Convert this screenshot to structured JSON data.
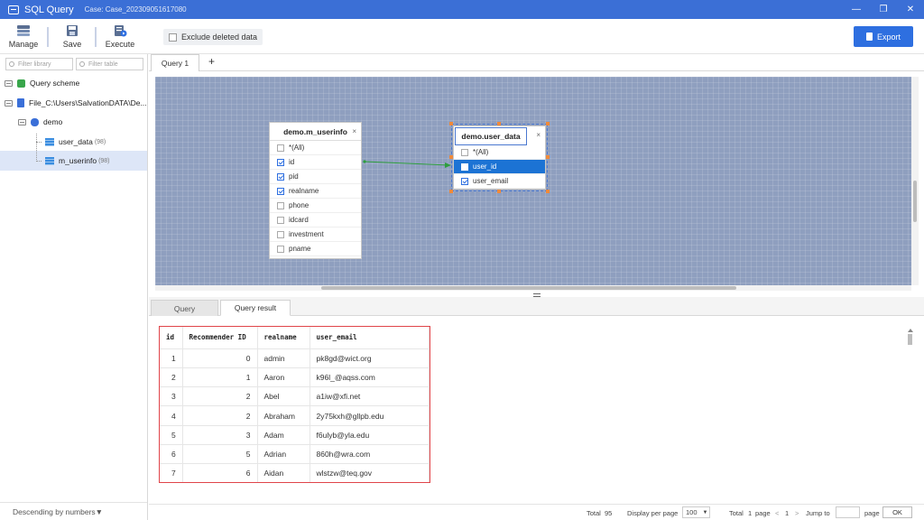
{
  "titlebar": {
    "title": "SQL Query",
    "case": "Case: Case_202309051617080",
    "minimize": "—",
    "restore": "❐",
    "close": "✕"
  },
  "toolbar": {
    "manage_label": "Manage",
    "save_label": "Save",
    "execute_label": "Execute",
    "exclude_label": "Exclude deleted data",
    "export_label": "Export"
  },
  "sidebar": {
    "filter_library_placeholder": "Filter library",
    "filter_table_placeholder": "Filter table",
    "items": [
      {
        "label": "Query scheme"
      },
      {
        "label": "File_C:\\Users\\SalvationDATA\\De..."
      },
      {
        "label": "demo"
      },
      {
        "label": "user_data",
        "count": "(98)"
      },
      {
        "label": "m_userinfo",
        "count": "(98)"
      }
    ],
    "sort_label": "Descending by numbers▼"
  },
  "query_tabs": {
    "tab1": "Query 1",
    "add": "+"
  },
  "canvas": {
    "table1": {
      "title": "demo.m_userinfo",
      "close": "×",
      "fields": [
        {
          "name": "*(All)",
          "checked": false
        },
        {
          "name": "id",
          "checked": true
        },
        {
          "name": "pid",
          "checked": true
        },
        {
          "name": "realname",
          "checked": true
        },
        {
          "name": "phone",
          "checked": false
        },
        {
          "name": "idcard",
          "checked": false
        },
        {
          "name": "investment",
          "checked": false
        },
        {
          "name": "pname",
          "checked": false
        }
      ]
    },
    "table2": {
      "title": "demo.user_data",
      "close": "×",
      "fields": [
        {
          "name": "*(All)",
          "checked": false
        },
        {
          "name": "user_id",
          "checked": false,
          "highlighted": true
        },
        {
          "name": "user_email",
          "checked": true
        }
      ]
    },
    "link_color": "#2e9e3e"
  },
  "result_tabs": {
    "tab_query": "Query",
    "tab_result": "Query result"
  },
  "results": {
    "columns": [
      "id",
      "Recommender ID",
      "realname",
      "user_email"
    ],
    "rows": [
      [
        "1",
        "0",
        "admin",
        "pk8gd@wict.org"
      ],
      [
        "2",
        "1",
        "Aaron",
        "k96l_@aqss.com"
      ],
      [
        "3",
        "2",
        "Abel",
        "a1iw@xfi.net"
      ],
      [
        "4",
        "2",
        "Abraham",
        "2y75kxh@gllpb.edu"
      ],
      [
        "5",
        "3",
        "Adam",
        "f6ulyb@yla.edu"
      ],
      [
        "6",
        "5",
        "Adrian",
        "860h@wra.com"
      ],
      [
        "7",
        "6",
        "Aidan",
        "wlstzw@teq.gov"
      ]
    ]
  },
  "pager": {
    "total_label": "Total",
    "total_value": "95",
    "per_page_label": "Display per page",
    "per_page_value": "100",
    "total_pages_label": "Total",
    "total_pages_value": "1",
    "page_word": "page",
    "prev": "<",
    "current": "1",
    "next": ">",
    "jump_label": "Jump to",
    "jump_page_word": "page",
    "ok": "OK"
  },
  "colors": {
    "titlebar": "#3b6fd6",
    "accent": "#2e6fe0",
    "canvas": "#8f9fbf",
    "highlight_row": "#1c73d4",
    "result_border": "#e0454a"
  }
}
